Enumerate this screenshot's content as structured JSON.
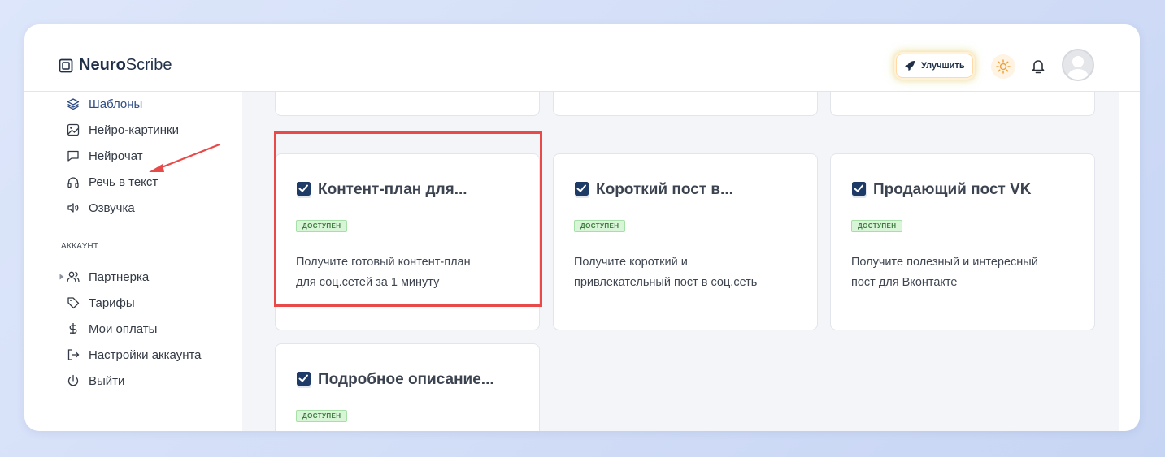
{
  "app": {
    "logo_bold": "Neuro",
    "logo_light": "Scribe"
  },
  "header": {
    "upgrade_label": "Улучшить"
  },
  "sidebar": {
    "items": [
      {
        "label": "Шаблоны",
        "icon": "layers-icon",
        "active": true
      },
      {
        "label": "Нейро-картинки",
        "icon": "image-icon"
      },
      {
        "label": "Нейрочат",
        "icon": "chat-icon"
      },
      {
        "label": "Речь в текст",
        "icon": "headphones-icon"
      },
      {
        "label": "Озвучка",
        "icon": "speaker-icon"
      }
    ],
    "account_label": "АККАУНТ",
    "account_items": [
      {
        "label": "Партнерка",
        "icon": "users-icon"
      },
      {
        "label": "Тарифы",
        "icon": "tag-icon"
      },
      {
        "label": "Мои оплаты",
        "icon": "dollar-icon"
      },
      {
        "label": "Настройки аккаунта",
        "icon": "logout-arrow-icon"
      },
      {
        "label": "Выйти",
        "icon": "power-icon"
      }
    ]
  },
  "cards": [
    {
      "title": "Контент-план для...",
      "badge": "ДОСТУПЕН",
      "desc_line1": "Получите готовый контент-план",
      "desc_line2": "для соц.сетей за 1 минуту"
    },
    {
      "title": "Короткий пост в...",
      "badge": "ДОСТУПЕН",
      "desc_line1": "Получите короткий и",
      "desc_line2": "привлекательный пост в соц.сеть"
    },
    {
      "title": "Продающий пост VK",
      "badge": "ДОСТУПЕН",
      "desc_line1": "Получите полезный и интересный",
      "desc_line2": "пост для Вконтакте"
    },
    {
      "title": "Подробное описание...",
      "badge": "ДОСТУПЕН"
    }
  ],
  "colors": {
    "accent": "#2f4d86",
    "highlight": "#e84a4a",
    "badge_bg": "#d8f5d8"
  }
}
